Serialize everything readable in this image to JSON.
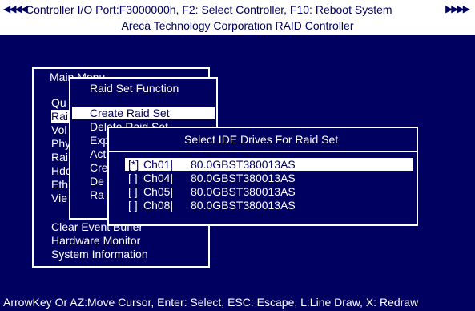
{
  "title": {
    "arrows_left": "◀◀◀◀",
    "arrows_right": "▶▶▶▶",
    "text": "Controller I/O Port:F3000000h, F2: Select Controller, F10: Reboot System",
    "subtitle": "Areca Technology Corporation RAID Controller"
  },
  "main_menu": {
    "title": "Main Menu",
    "items": [
      "Qu",
      "Rai",
      "Vol",
      "Phy",
      "Rai",
      "Hdd",
      "Eth",
      "Vie",
      "Clear Event Buffer",
      "Hardware Monitor",
      "System Information"
    ],
    "selected_index": 1
  },
  "raid_menu": {
    "title": "Raid Set Function",
    "items": [
      "Create Raid Set",
      "Delete Raid Set",
      "Exp",
      "Act",
      "Cre",
      "De",
      "Ra"
    ],
    "selected_index": 0
  },
  "drive_dialog": {
    "title": "Select IDE Drives For Raid Set",
    "drives": [
      {
        "mark": "[*]",
        "channel": "Ch01|",
        "model": "80.0GBST380013AS"
      },
      {
        "mark": "[ ]",
        "channel": "Ch04|",
        "model": "80.0GBST380013AS"
      },
      {
        "mark": "[ ]",
        "channel": "Ch05|",
        "model": "80.0GBST380013AS"
      },
      {
        "mark": "[ ]",
        "channel": "Ch08|",
        "model": "80.0GBST380013AS"
      }
    ],
    "selected_index": 0
  },
  "status_bar": "ArrowKey Or AZ:Move Cursor, Enter: Select, ESC: Escape, L:Line Draw, X: Redraw",
  "colors": {
    "background": "#000060",
    "foreground": "#ffffff",
    "highlight": "#ffffff",
    "highlight_text": "#000060"
  }
}
